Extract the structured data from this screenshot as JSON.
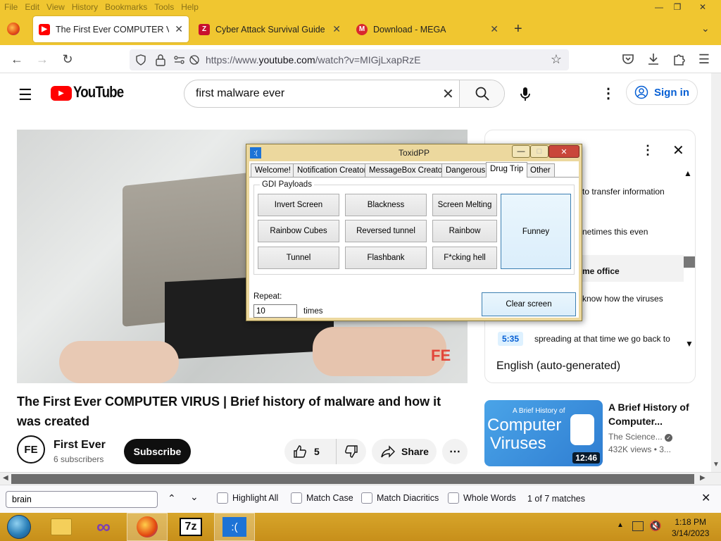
{
  "browser": {
    "menu": [
      "File",
      "Edit",
      "View",
      "History",
      "Bookmarks",
      "Tools",
      "Help"
    ],
    "tabs": [
      {
        "label": "The First Ever COMPUTER VIRUS",
        "favicon": "youtube-icon",
        "active": true
      },
      {
        "label": "Cyber Attack Survival Guide - Z",
        "favicon": "z-icon"
      },
      {
        "label": "Download - MEGA",
        "favicon": "mega-icon"
      }
    ],
    "new_tab": "+",
    "url_prefix": "https://www.",
    "url_host": "youtube.com",
    "url_path": "/watch?v=MIGjLxapRzE"
  },
  "youtube": {
    "logo": "YouTube",
    "search_value": "first malware ever",
    "sign_in": "Sign in",
    "video_title": "The First Ever COMPUTER VIRUS | Brief history of malware and how it was created",
    "channel": {
      "name": "First Ever",
      "subscribers": "6 subscribers",
      "avatar_text": "FE"
    },
    "subscribe": "Subscribe",
    "likes": "5",
    "share": "Share",
    "more": "⋯",
    "transcript": {
      "lines": [
        "to transfer information",
        "netimes this even",
        "me office",
        "know how the viruses"
      ],
      "timestamp": "5:35",
      "current_text": "spreading at that time we go back to",
      "language": "English (auto-generated)"
    },
    "recommended": {
      "title": "A Brief History of Computer...",
      "channel": "The Science...",
      "views": "432K views • 3...",
      "duration": "12:46",
      "thumb_small": "A Brief History of",
      "thumb_line1": "Computer",
      "thumb_line2": "Viruses"
    }
  },
  "toxid": {
    "title": "ToxidPP",
    "icon_text": ":(",
    "tabs": [
      "Welcome!",
      "Notification Creator",
      "MessageBox Creator",
      "Dangerous",
      "Drug Trip",
      "Other"
    ],
    "active_tab": "Drug Trip",
    "group_label": "GDI Payloads",
    "buttons": [
      "Invert Screen",
      "Blackness",
      "Screen Melting",
      "Rainbow Cubes",
      "Reversed tunnel",
      "Rainbow",
      "Tunnel",
      "Flashbank",
      "F*cking hell"
    ],
    "funney": "Funney",
    "repeat_label": "Repeat:",
    "repeat_value": "10",
    "times_label": "times",
    "clear_screen": "Clear screen"
  },
  "findbar": {
    "query": "brain",
    "highlight_all": "Highlight All",
    "match_case": "Match Case",
    "match_diacritics": "Match Diacritics",
    "whole_words": "Whole Words",
    "result": "1 of 7 matches"
  },
  "taskbar": {
    "time": "1:18 PM",
    "date": "3/14/2023",
    "app_7z": "7z",
    "app_toxid": ":("
  },
  "colors": {
    "firefox_tabbar": "#f0c630",
    "yt_red": "#ff0000",
    "yt_blue": "#065fd4",
    "taskbar": "#c78f1a"
  }
}
